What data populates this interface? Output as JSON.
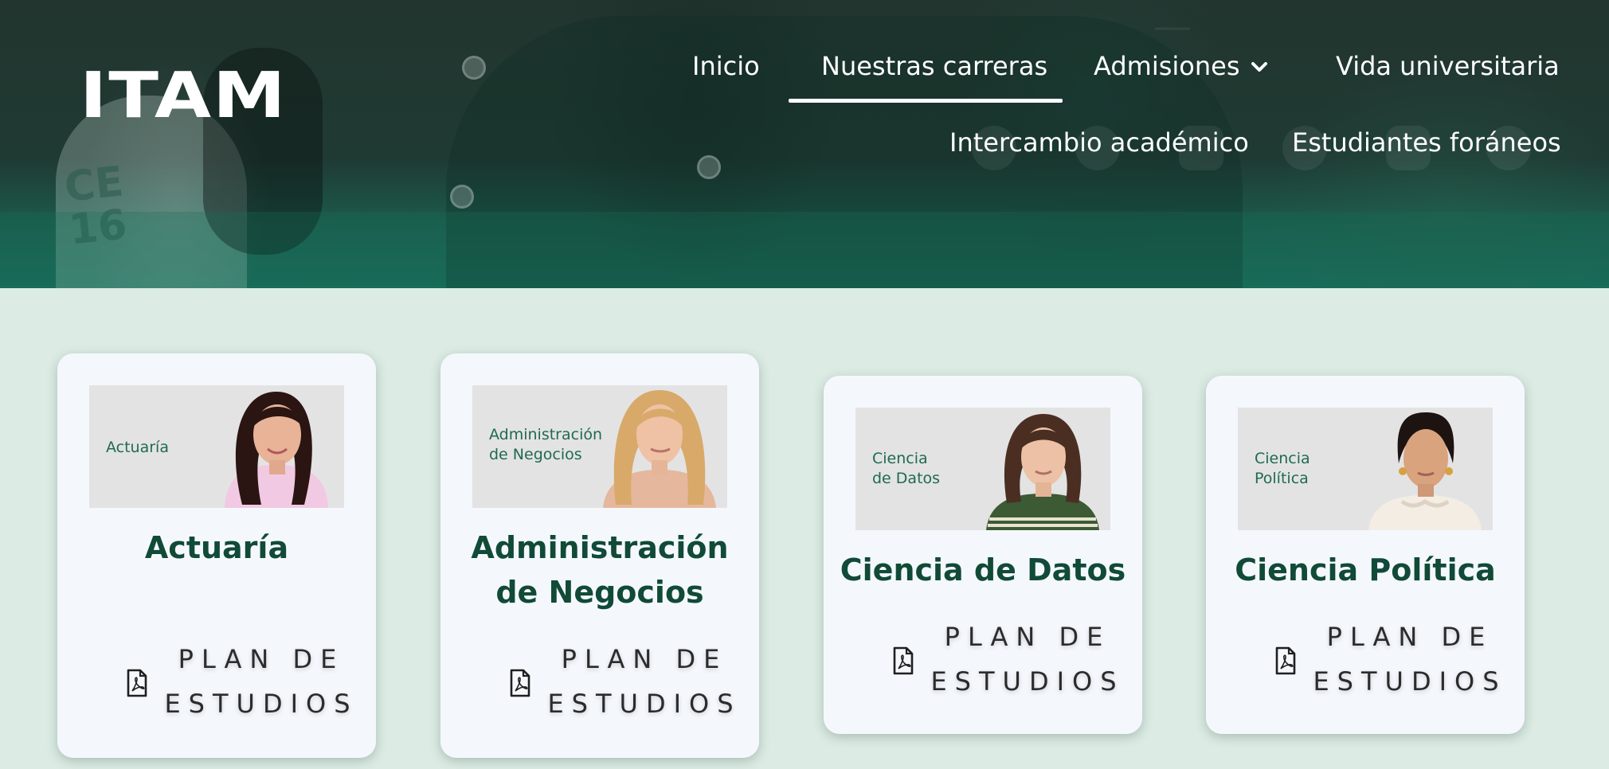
{
  "header": {
    "logo_text": "ITAM",
    "nav_row1": [
      {
        "label": "Inicio"
      },
      {
        "label": "Nuestras carreras",
        "active": true
      },
      {
        "label": "Admisiones",
        "has_dropdown": true
      },
      {
        "label": "Vida universitaria"
      }
    ],
    "nav_row2": [
      {
        "label": "Intercambio académico"
      },
      {
        "label": "Estudiantes foráneos"
      }
    ]
  },
  "cards": [
    {
      "thumb_label_line1": "Actuaría",
      "thumb_label_line2": "",
      "title_line1": "Actuaría",
      "title_line2": "",
      "plan_line1": "PLAN DE",
      "plan_line2": "ESTUDIOS",
      "icon": "pdf-icon"
    },
    {
      "thumb_label_line1": "Administración",
      "thumb_label_line2": "de Negocios",
      "title_line1": "Administración",
      "title_line2": "de Negocios",
      "plan_line1": "PLAN DE",
      "plan_line2": "ESTUDIOS",
      "icon": "pdf-icon"
    },
    {
      "thumb_label_line1": "Ciencia",
      "thumb_label_line2": "de Datos",
      "title_line1": "Ciencia de Datos",
      "title_line2": "",
      "plan_line1": "PLAN DE",
      "plan_line2": "ESTUDIOS",
      "icon": "pdf-icon"
    },
    {
      "thumb_label_line1": "Ciencia",
      "thumb_label_line2": "Política",
      "title_line1": "Ciencia Política",
      "title_line2": "",
      "plan_line1": "PLAN DE",
      "plan_line2": "ESTUDIOS",
      "icon": "pdf-icon"
    }
  ],
  "colors": {
    "page_background": "#dcece4",
    "header_dark": "#23352f",
    "card_background": "#f4f8fd",
    "title_green": "#114a36",
    "thumb_label_green": "#1f6a52"
  }
}
